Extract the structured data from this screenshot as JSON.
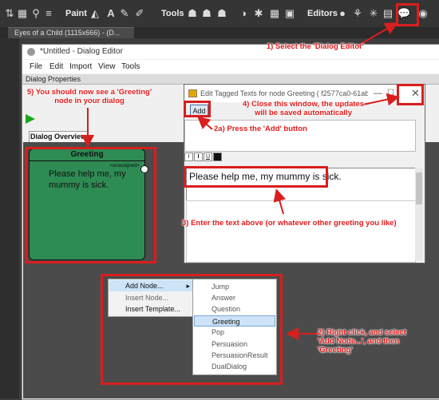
{
  "app_toolbar": {
    "paint_label": "Paint",
    "tools_label": "Tools",
    "editors_label": "Editors"
  },
  "document_tab": {
    "label": "Eyes of a Child (1115x666) - (D..."
  },
  "dialog_editor": {
    "title": "*Untitled - Dialog Editor",
    "menu": [
      "File",
      "Edit",
      "Import",
      "View",
      "Tools"
    ],
    "properties_label": "Dialog Properties",
    "overview_tab": "Dialog Overview",
    "node": {
      "title": "Greeting",
      "tag": "<unassigned>",
      "text": "Please help me, my mummy is sick."
    }
  },
  "edit_window": {
    "title": "Edit Tagged Texts for node Greeting ( f2577ca0-61ab-4...",
    "add_button": "Add",
    "format_buttons": [
      "I",
      "U"
    ],
    "text": "Please help me, my mummy is sick."
  },
  "context_menu": {
    "items": [
      "Add Node...",
      "Insert Node...",
      "Insert Template..."
    ],
    "submenu_arrow": "▸",
    "submenu_items": [
      "Jump",
      "Answer",
      "Question",
      "Greeting",
      "Pop",
      "Persuasion",
      "PersuasionResult",
      "DualDialog"
    ],
    "selected_item": "Greeting"
  },
  "annotations": {
    "step1": "1) Select the 'Dialog Editor'",
    "step2a": "2a) Press the 'Add' button",
    "step3": "3) Enter the text above (or whatever other greeting you like)",
    "step4_line1": "4) Close this window, the updates",
    "step4_line2": "will be saved automatically",
    "step5_line1": "5) You should now see a 'Greeting'",
    "step5_line2": "node in your dialog",
    "step2_line1": "2) Right click, and select",
    "step2_line2": "'Add Node...', and then",
    "step2_line3": "'Greeting'"
  },
  "colors": {
    "annotation_red": "#d81e1e",
    "node_green": "#2e8b54",
    "selected_highlight": "#cde3f7"
  }
}
